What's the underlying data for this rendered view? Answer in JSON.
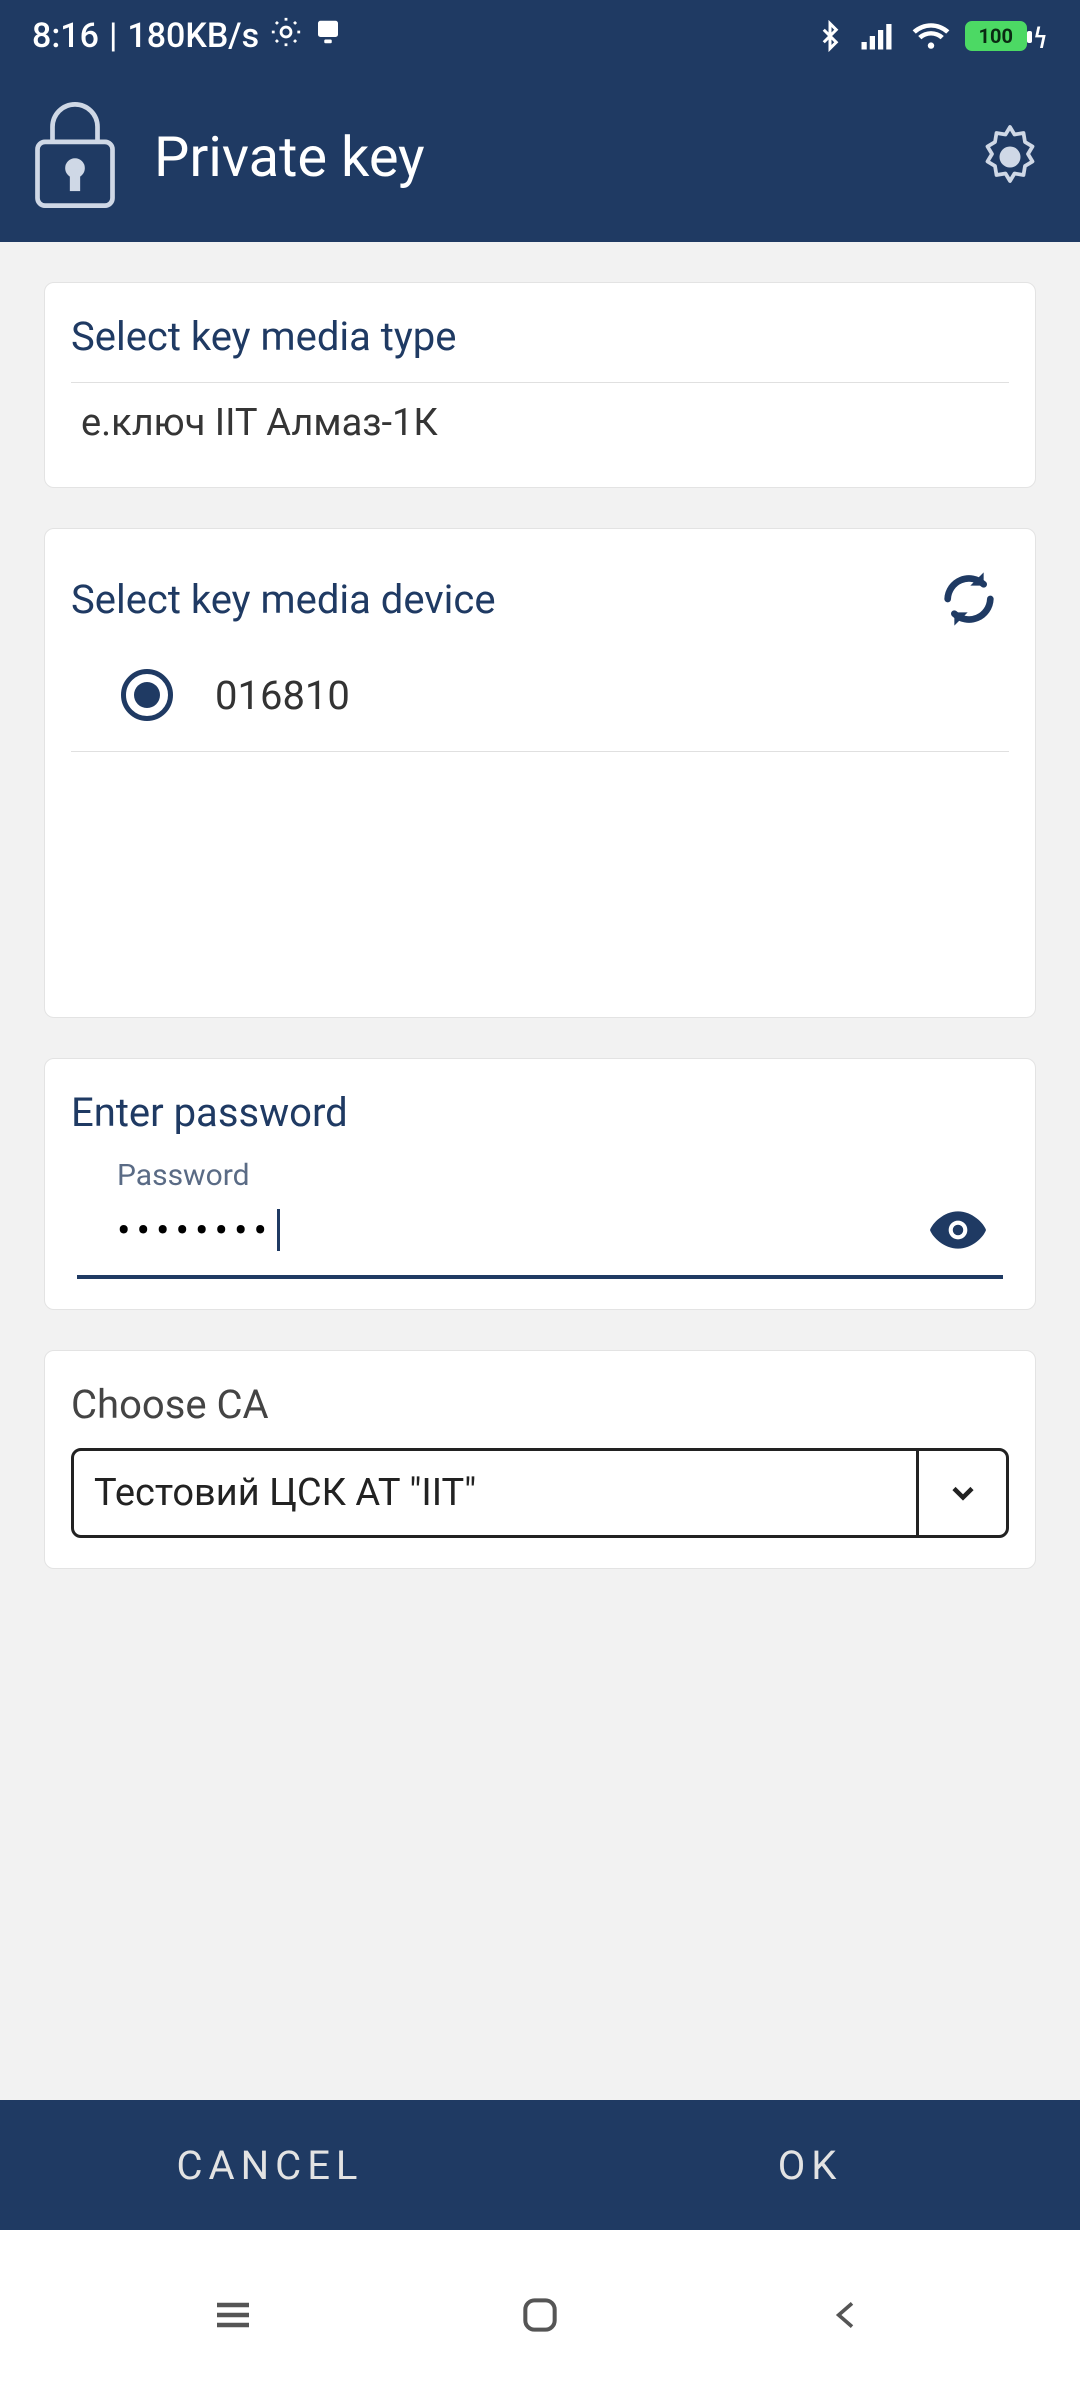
{
  "status": {
    "time": "8:16",
    "net_speed": "180KB/s",
    "battery_pct": "100"
  },
  "header": {
    "title": "Private key"
  },
  "media_type": {
    "label": "Select key media type",
    "value": "е.ключ ІІТ Алмаз-1К"
  },
  "media_device": {
    "label": "Select key media device",
    "options": [
      {
        "id": "016810",
        "label": "016810",
        "selected": true
      }
    ]
  },
  "password": {
    "label": "Enter password",
    "float_label": "Password",
    "value_masked": "••••••••"
  },
  "ca": {
    "label": "Choose CA",
    "selected": "Тестовий ЦСК АТ \"ІІТ\""
  },
  "buttons": {
    "cancel": "CANCEL",
    "ok": "OK"
  }
}
